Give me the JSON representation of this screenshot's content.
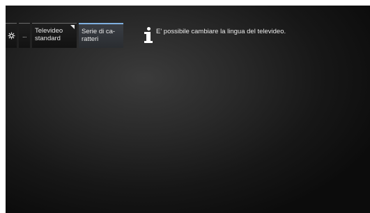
{
  "menu": {
    "settings_icon": "gear-icon",
    "more_label": "...",
    "teletext_label": "Televideo standard",
    "charset_label": "Serie di ca-ratteri"
  },
  "info": {
    "icon": "info-icon",
    "message": "E' possibile cambiare la lingua del televideo."
  },
  "colors": {
    "selected_accent": "#7fb0e0",
    "background": "#1a1a1a"
  }
}
